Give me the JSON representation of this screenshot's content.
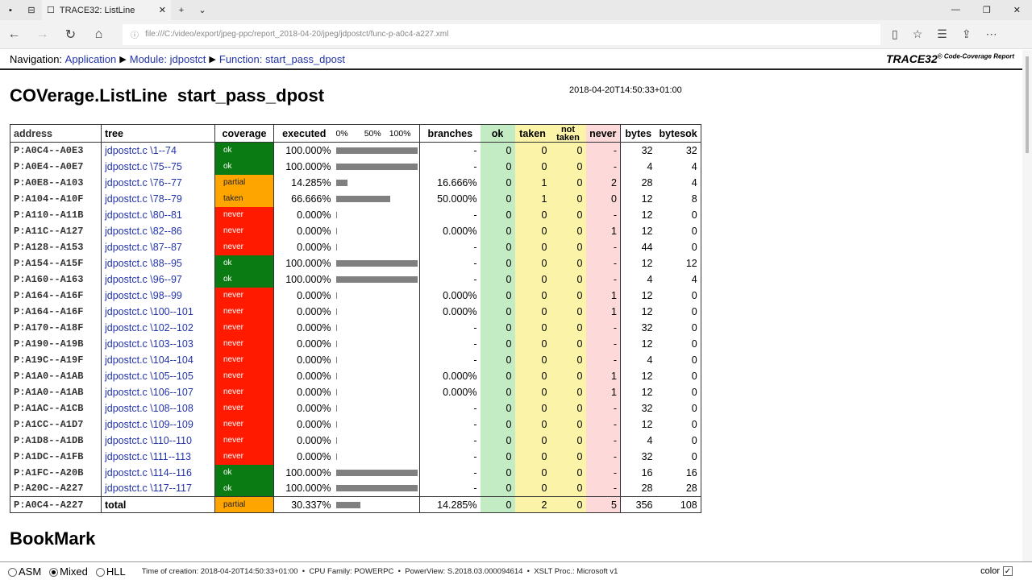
{
  "browser": {
    "tab_title": "TRACE32: ListLine",
    "url": "file:///C:/video/export/jpeg-ppc/report_2018-04-20/jpeg/jdpostct/func-p-a0c4-a227.xml"
  },
  "nav": {
    "label": "Navigation:",
    "application": "Application",
    "module": "Module: jdpostct",
    "function": "Function: start_pass_dpost",
    "brand": "TRACE32",
    "brand_suffix": "© Code-Coverage Report"
  },
  "title": "COVerage.ListLine  start_pass_dpost",
  "timestamp": "2018-04-20T14:50:33+01:00",
  "columns": {
    "address": "address",
    "tree": "tree",
    "coverage": "coverage",
    "executed": "executed",
    "bar0": "0%",
    "bar50": "50%",
    "bar100": "100%",
    "branches": "branches",
    "ok": "ok",
    "taken": "taken",
    "not_taken": "not taken",
    "never": "never",
    "bytes": "bytes",
    "bytesok": "bytesok"
  },
  "rows": [
    [
      "P:A0C4--A0E3",
      "jdpostct.c \\1--74",
      "ok",
      "100.000%",
      "-",
      "0",
      "0",
      "0",
      "-",
      "32",
      "32"
    ],
    [
      "P:A0E4--A0E7",
      "jdpostct.c \\75--75",
      "ok",
      "100.000%",
      "-",
      "0",
      "0",
      "0",
      "-",
      "4",
      "4"
    ],
    [
      "P:A0E8--A103",
      "jdpostct.c \\76--77",
      "partial",
      "14.285%",
      "16.666%",
      "0",
      "1",
      "0",
      "2",
      "28",
      "4"
    ],
    [
      "P:A104--A10F",
      "jdpostct.c \\78--79",
      "taken",
      "66.666%",
      "50.000%",
      "0",
      "1",
      "0",
      "0",
      "12",
      "8"
    ],
    [
      "P:A110--A11B",
      "jdpostct.c \\80--81",
      "never",
      "0.000%",
      "-",
      "0",
      "0",
      "0",
      "-",
      "12",
      "0"
    ],
    [
      "P:A11C--A127",
      "jdpostct.c \\82--86",
      "never",
      "0.000%",
      "0.000%",
      "0",
      "0",
      "0",
      "1",
      "12",
      "0"
    ],
    [
      "P:A128--A153",
      "jdpostct.c \\87--87",
      "never",
      "0.000%",
      "-",
      "0",
      "0",
      "0",
      "-",
      "44",
      "0"
    ],
    [
      "P:A154--A15F",
      "jdpostct.c \\88--95",
      "ok",
      "100.000%",
      "-",
      "0",
      "0",
      "0",
      "-",
      "12",
      "12"
    ],
    [
      "P:A160--A163",
      "jdpostct.c \\96--97",
      "ok",
      "100.000%",
      "-",
      "0",
      "0",
      "0",
      "-",
      "4",
      "4"
    ],
    [
      "P:A164--A16F",
      "jdpostct.c \\98--99",
      "never",
      "0.000%",
      "0.000%",
      "0",
      "0",
      "0",
      "1",
      "12",
      "0"
    ],
    [
      "P:A164--A16F",
      "jdpostct.c \\100--101",
      "never",
      "0.000%",
      "0.000%",
      "0",
      "0",
      "0",
      "1",
      "12",
      "0"
    ],
    [
      "P:A170--A18F",
      "jdpostct.c \\102--102",
      "never",
      "0.000%",
      "-",
      "0",
      "0",
      "0",
      "-",
      "32",
      "0"
    ],
    [
      "P:A190--A19B",
      "jdpostct.c \\103--103",
      "never",
      "0.000%",
      "-",
      "0",
      "0",
      "0",
      "-",
      "12",
      "0"
    ],
    [
      "P:A19C--A19F",
      "jdpostct.c \\104--104",
      "never",
      "0.000%",
      "-",
      "0",
      "0",
      "0",
      "-",
      "4",
      "0"
    ],
    [
      "P:A1A0--A1AB",
      "jdpostct.c \\105--105",
      "never",
      "0.000%",
      "0.000%",
      "0",
      "0",
      "0",
      "1",
      "12",
      "0"
    ],
    [
      "P:A1A0--A1AB",
      "jdpostct.c \\106--107",
      "never",
      "0.000%",
      "0.000%",
      "0",
      "0",
      "0",
      "1",
      "12",
      "0"
    ],
    [
      "P:A1AC--A1CB",
      "jdpostct.c \\108--108",
      "never",
      "0.000%",
      "-",
      "0",
      "0",
      "0",
      "-",
      "32",
      "0"
    ],
    [
      "P:A1CC--A1D7",
      "jdpostct.c \\109--109",
      "never",
      "0.000%",
      "-",
      "0",
      "0",
      "0",
      "-",
      "12",
      "0"
    ],
    [
      "P:A1D8--A1DB",
      "jdpostct.c \\110--110",
      "never",
      "0.000%",
      "-",
      "0",
      "0",
      "0",
      "-",
      "4",
      "0"
    ],
    [
      "P:A1DC--A1FB",
      "jdpostct.c \\111--113",
      "never",
      "0.000%",
      "-",
      "0",
      "0",
      "0",
      "-",
      "32",
      "0"
    ],
    [
      "P:A1FC--A20B",
      "jdpostct.c \\114--116",
      "ok",
      "100.000%",
      "-",
      "0",
      "0",
      "0",
      "-",
      "16",
      "16"
    ],
    [
      "P:A20C--A227",
      "jdpostct.c \\117--117",
      "ok",
      "100.000%",
      "-",
      "0",
      "0",
      "0",
      "-",
      "28",
      "28"
    ]
  ],
  "total": [
    "P:A0C4--A227",
    "total",
    "partial",
    "30.337%",
    "14.285%",
    "0",
    "2",
    "0",
    "5",
    "356",
    "108"
  ],
  "bookmark": "BookMark",
  "footer": {
    "asm": "ASM",
    "mixed": "Mixed",
    "hll": "HLL",
    "selected": "Mixed",
    "info": "Time of creation: 2018-04-20T14:50:33+01:00  •  CPU Family: POWERPC  •  PowerView: S.2018.03.000094614  •  XSLT Proc.: Microsoft v1",
    "color": "color",
    "color_checked": true
  }
}
